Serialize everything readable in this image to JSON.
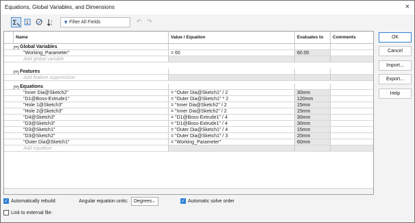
{
  "window": {
    "title": "Equations, Global Variables, and Dimensions",
    "close_label": "×"
  },
  "toolbar": {
    "buttons": [
      "sigma-filter-icon",
      "sketch-view-icon",
      "dimension-view-icon",
      "ordered-view-icon"
    ],
    "filter_placeholder": "Filter All Fields",
    "filter_icon": "▼",
    "undo_label": "↶",
    "redo_label": "↷"
  },
  "table": {
    "headers": {
      "name": "Name",
      "value": "Value / Equation",
      "evaluates": "Evaluates to",
      "comments": "Comments"
    },
    "groups": {
      "global": {
        "label": "Global Variables",
        "toggle": "−"
      },
      "features": {
        "label": "Features",
        "toggle": "−"
      },
      "equations": {
        "label": "Equations",
        "toggle": "−"
      }
    },
    "global_rows": [
      {
        "name": "\"Working_Parameter\"",
        "value": "= 60",
        "evaluates": "60.00",
        "comments": ""
      }
    ],
    "add_global": "Add global variable",
    "add_feature": "Add feature suppression",
    "equation_rows": [
      {
        "name": "\"Inner Dia@Sketch2\"",
        "value": "= \"Outer Dia@Sketch1\" / 2",
        "evaluates": "30mm"
      },
      {
        "name": "\"D1@Boss-Extrude1\"",
        "value": "= \"Outer Dia@Sketch1\" * 2",
        "evaluates": "120mm"
      },
      {
        "name": "\"Hole 1@Sketch3\"",
        "value": "= \"Inner Dia@Sketch2\" / 2",
        "evaluates": "15mm"
      },
      {
        "name": "\"Hole 2@Sketch3\"",
        "value": "= \"Inner Dia@Sketch2\" / 2",
        "evaluates": "15mm"
      },
      {
        "name": "\"D4@Sketch3\"",
        "value": "= \"D1@Boss-Extrude1\" / 4",
        "evaluates": "30mm"
      },
      {
        "name": "\"D3@Sketch3\"",
        "value": "= \"D1@Boss-Extrude1\" / 4",
        "evaluates": "30mm"
      },
      {
        "name": "\"D3@Sketch1\"",
        "value": "= \"Outer Dia@Sketch1\" / 4",
        "evaluates": "15mm"
      },
      {
        "name": "\"D3@Sketch2\"",
        "value": "= \"Outer Dia@Sketch1\" / 3",
        "evaluates": "20mm"
      },
      {
        "name": "\"Outer Dia@Sketch1\"",
        "value": "= \"Working_Parameter\"",
        "evaluates": "60mm"
      }
    ],
    "add_equation": "Add equation"
  },
  "side_buttons": {
    "ok": "OK",
    "cancel": "Cancel",
    "import": "Import...",
    "export": "Export...",
    "help": "Help"
  },
  "options": {
    "auto_rebuild": "Automatically rebuild",
    "angular_units_label": "Angular equation units:",
    "angular_units_value": "Degrees",
    "auto_solve": "Automatic solve order",
    "link_external": "Link to external file:",
    "check_mark": "✓"
  },
  "colors": {
    "accent": "#2f7fd6",
    "grey_cell": "#e7e7e7"
  }
}
